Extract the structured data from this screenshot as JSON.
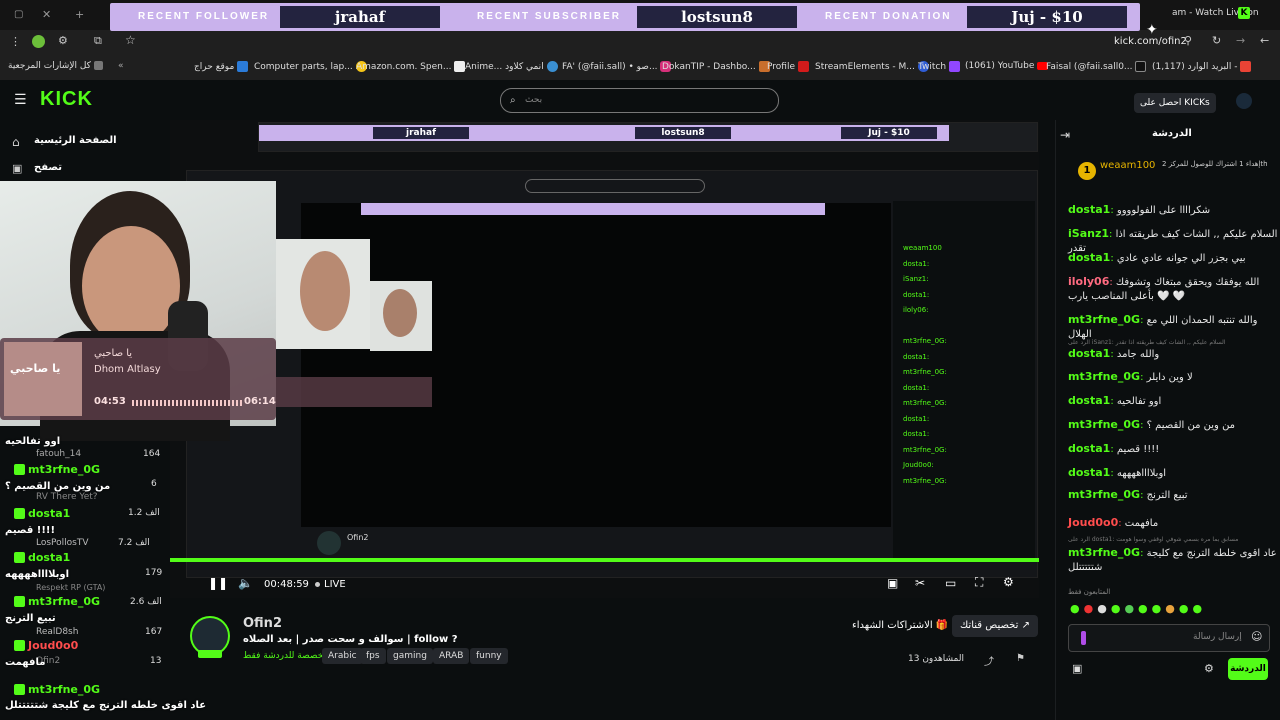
{
  "overlay": {
    "follower_label": "RECENT FOLLOWER",
    "follower": "jrahaf",
    "subscriber_label": "RECENT SUBSCRIBER",
    "subscriber": "lostsun8",
    "donation_label": "RECENT DONATION",
    "donation": "Juj - $10"
  },
  "browser": {
    "tab_title": "am - Watch Live on",
    "url": "kick.com/ofin2",
    "bookmarks_label": "كل الإشارات المرجعية",
    "bookmarks": [
      "موقع حراج",
      "Computer parts, lap...",
      "Amazon.com. Spen...",
      "Anime... انمي كلاود",
      "FA' (@faii.sall) • صو...",
      "DokanTIP - Dashbo...",
      "Profile",
      "StreamElements - M...",
      "Twitch",
      "(1061) YouTube",
      "Faisal (@faii.sall0...",
      "(1,117) البريد الوارد -"
    ]
  },
  "kick": {
    "logo": "KICK",
    "search_placeholder": "بحث",
    "home": "الصفحة الرئيسية",
    "browse": "تصفح",
    "get_kicks": "احصل على KICKs"
  },
  "music": {
    "title": "يا صاحبي",
    "artist": "Dhom Altlasy",
    "elapsed": "04:53",
    "total": "06:14",
    "cover_text": "يا صاحبي"
  },
  "left_chat": [
    {
      "name": "dosta1",
      "msg": "اوو تفالحيه"
    },
    {
      "name": "mt3rfne_0G",
      "msg": "من وين من القصيم ؟"
    },
    {
      "name": "dosta1",
      "msg": "قصيم !!!!"
    },
    {
      "name": "dosta1",
      "msg": "اوبلااااههههه"
    },
    {
      "name": "mt3rfne_0G",
      "msg": "تبيع الترنج"
    },
    {
      "name": "Joud0o0",
      "msg": "مافهمت"
    },
    {
      "name": "mt3rfne_0G",
      "msg": "عاد اقوى خلطه الترنج مع كليجة شتتتتتلل"
    }
  ],
  "sidebar_streams": [
    {
      "name": "fatouh_14",
      "viewers": "164"
    },
    {
      "name": "RV There Yet?",
      "viewers": "6"
    },
    {
      "name": "",
      "viewers": "الف 1.2"
    },
    {
      "name": "LosPollosTV",
      "viewers": "الف 7.2"
    },
    {
      "name": "",
      "viewers": "179"
    },
    {
      "name": "Respekt RP (GTA)",
      "viewers": "الف 2.6"
    },
    {
      "name": "RealD8sh",
      "viewers": "167"
    },
    {
      "name": "Ofin2",
      "viewers": "13"
    }
  ],
  "player": {
    "time": "00:48:59",
    "live": "LIVE"
  },
  "stream": {
    "streamer": "Ofin2",
    "title": "سوالف و سحت صدر | بعد الصلاه | follow ?",
    "category": "مخصصة للدردشة فقط",
    "tags": [
      "Arabic",
      "fps",
      "gaming",
      "ARAB",
      "funny"
    ],
    "customize": "تخصيص قناتك",
    "subs_button": "الاشتراكات الشهداء",
    "viewers": "المشاهدون 13"
  },
  "chat": {
    "title": "الدردشة",
    "pinned_user": "weaam100",
    "pinned_text": "إهداء 1 اشتراك للوصول للمركز 2th",
    "messages": [
      {
        "name": "dosta1",
        "color": "#53fc18",
        "text": "شكراااا على الفولوووو"
      },
      {
        "name": "iSanz1",
        "color": "#53fc18",
        "text": "السلام عليكم ,, الشات كيف طريقته اذا تقدر"
      },
      {
        "name": "dosta1",
        "color": "#53fc18",
        "text": "بيي بجزر الي جوانه عادي عادي"
      },
      {
        "name": "iloly06",
        "color": "#ff6b81",
        "text": "الله يوفقك ويحقق مبتغاك وتشوفك بأعلى المناصب يارب 🤍 🤍"
      },
      {
        "name": "mt3rfne_0G",
        "color": "#53fc18",
        "text": "والله تنتبه الحمدان اللي مع الهلال"
      },
      {
        "name": "dosta1",
        "color": "#53fc18",
        "text": "والله جامد"
      },
      {
        "name": "mt3rfne_0G",
        "color": "#53fc18",
        "text": "لا وين دايلر"
      },
      {
        "name": "dosta1",
        "color": "#53fc18",
        "text": "اوو تفالحيه"
      },
      {
        "name": "mt3rfne_0G",
        "color": "#53fc18",
        "text": "من وين من القصيم ؟"
      },
      {
        "name": "dosta1",
        "color": "#53fc18",
        "text": "قصيم !!!!"
      },
      {
        "name": "dosta1",
        "color": "#53fc18",
        "text": "اوبلااااههههه"
      },
      {
        "name": "mt3rfne_0G",
        "color": "#53fc18",
        "text": "تبيع الترنج"
      },
      {
        "name": "Joud0o0",
        "color": "#ff4d4d",
        "text": "مافهمت"
      },
      {
        "name": "mt3rfne_0G",
        "color": "#53fc18",
        "text": "عاد اقوى خلطه الترنج مع كليجة شتتتتتلل"
      }
    ],
    "reply_hint": "الرد على iSanz1: السلام عليكم ,, الشات كيف طريقته اذا تقدر",
    "reply_hint2": "الرد على dosta1: مسابق بما مره بسمي شوفي اوقفي وسوا هومت",
    "followers_only": "المتابعون فقط",
    "input_placeholder": "إرسال رسالة",
    "send_button": "الدردشة"
  },
  "colors": {
    "kick_green": "#53fc18",
    "overlay_purple": "#c9b2ec",
    "overlay_box": "#23233f"
  }
}
